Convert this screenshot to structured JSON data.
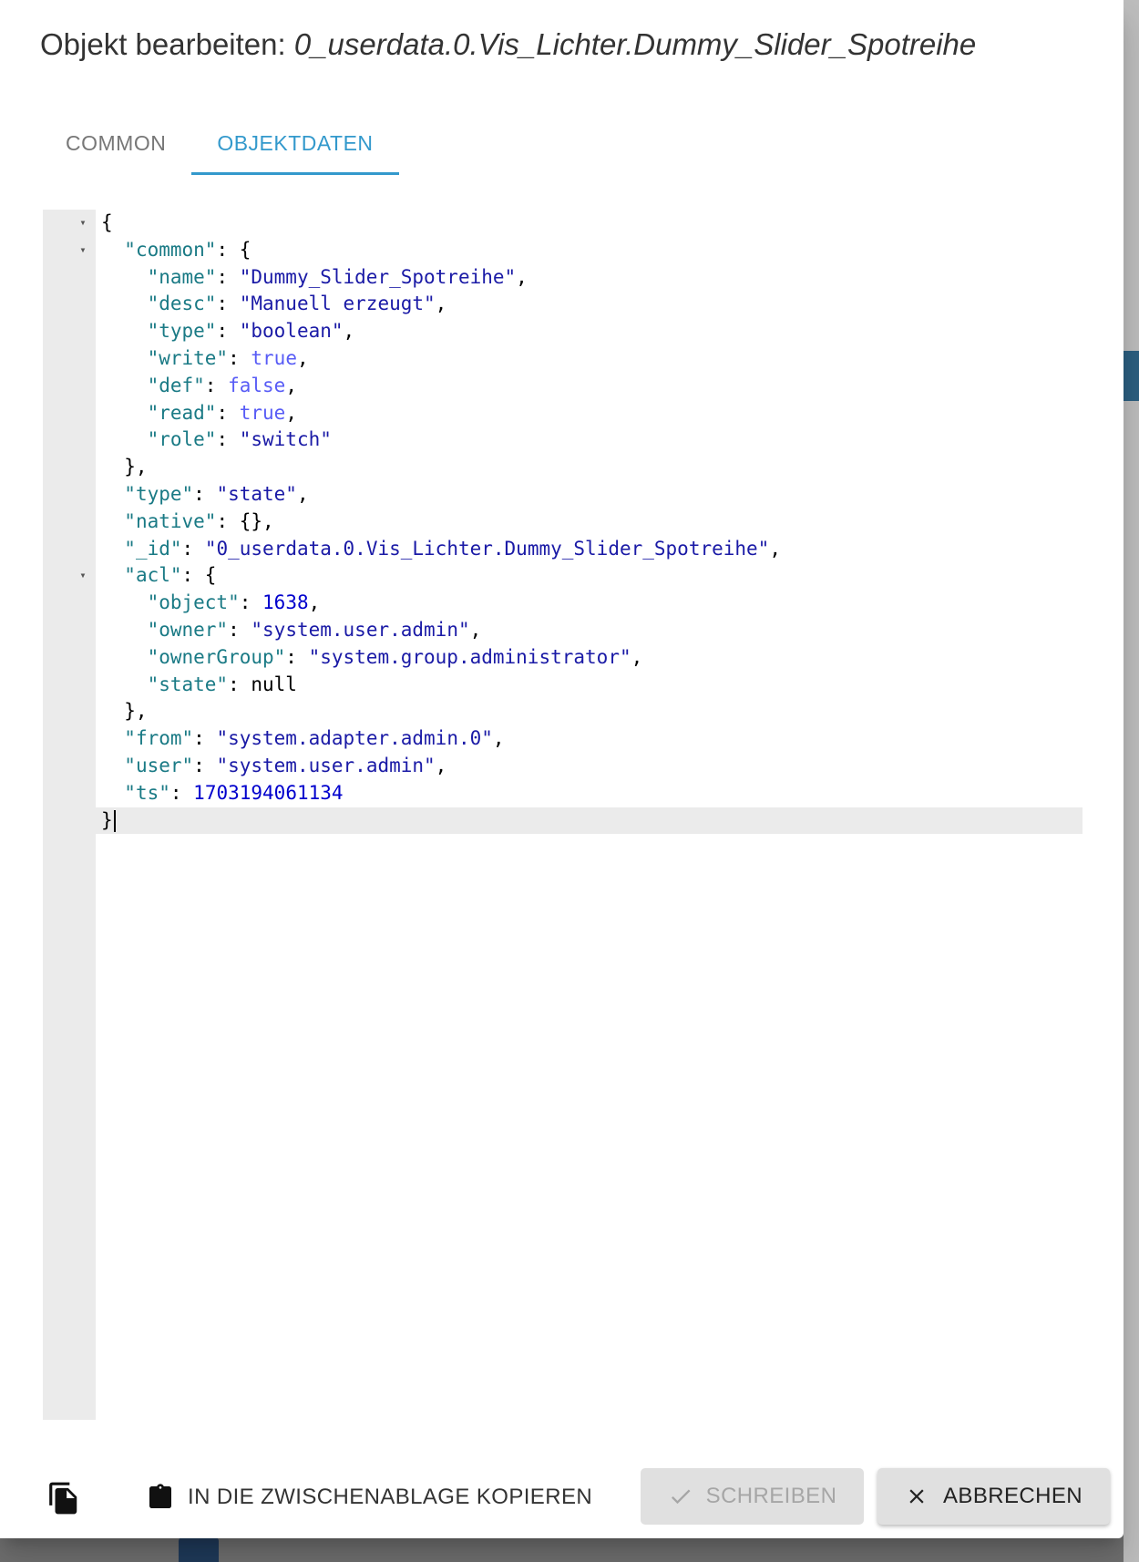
{
  "dialog": {
    "title_prefix": "Objekt bearbeiten: ",
    "title_object_id": "0_userdata.0.Vis_Lichter.Dummy_Slider_Spotreihe"
  },
  "tabs": [
    {
      "label": "COMMON",
      "active": false
    },
    {
      "label": "OBJEKTDATEN",
      "active": true
    }
  ],
  "editor": {
    "lines": [
      {
        "fold": true,
        "tokens": [
          [
            "p",
            "{"
          ]
        ]
      },
      {
        "fold": true,
        "tokens": [
          [
            "p",
            "  "
          ],
          [
            "k",
            "\"common\""
          ],
          [
            "p",
            ": {"
          ]
        ]
      },
      {
        "fold": false,
        "tokens": [
          [
            "p",
            "    "
          ],
          [
            "k",
            "\"name\""
          ],
          [
            "p",
            ": "
          ],
          [
            "s",
            "\"Dummy_Slider_Spotreihe\""
          ],
          [
            "p",
            ","
          ]
        ]
      },
      {
        "fold": false,
        "tokens": [
          [
            "p",
            "    "
          ],
          [
            "k",
            "\"desc\""
          ],
          [
            "p",
            ": "
          ],
          [
            "s",
            "\"Manuell erzeugt\""
          ],
          [
            "p",
            ","
          ]
        ]
      },
      {
        "fold": false,
        "tokens": [
          [
            "p",
            "    "
          ],
          [
            "k",
            "\"type\""
          ],
          [
            "p",
            ": "
          ],
          [
            "s",
            "\"boolean\""
          ],
          [
            "p",
            ","
          ]
        ]
      },
      {
        "fold": false,
        "tokens": [
          [
            "p",
            "    "
          ],
          [
            "k",
            "\"write\""
          ],
          [
            "p",
            ": "
          ],
          [
            "b",
            "true"
          ],
          [
            "p",
            ","
          ]
        ]
      },
      {
        "fold": false,
        "tokens": [
          [
            "p",
            "    "
          ],
          [
            "k",
            "\"def\""
          ],
          [
            "p",
            ": "
          ],
          [
            "b",
            "false"
          ],
          [
            "p",
            ","
          ]
        ]
      },
      {
        "fold": false,
        "tokens": [
          [
            "p",
            "    "
          ],
          [
            "k",
            "\"read\""
          ],
          [
            "p",
            ": "
          ],
          [
            "b",
            "true"
          ],
          [
            "p",
            ","
          ]
        ]
      },
      {
        "fold": false,
        "tokens": [
          [
            "p",
            "    "
          ],
          [
            "k",
            "\"role\""
          ],
          [
            "p",
            ": "
          ],
          [
            "s",
            "\"switch\""
          ]
        ]
      },
      {
        "fold": false,
        "tokens": [
          [
            "p",
            "  },"
          ]
        ]
      },
      {
        "fold": false,
        "tokens": [
          [
            "p",
            "  "
          ],
          [
            "k",
            "\"type\""
          ],
          [
            "p",
            ": "
          ],
          [
            "s",
            "\"state\""
          ],
          [
            "p",
            ","
          ]
        ]
      },
      {
        "fold": false,
        "tokens": [
          [
            "p",
            "  "
          ],
          [
            "k",
            "\"native\""
          ],
          [
            "p",
            ": {},"
          ]
        ]
      },
      {
        "fold": false,
        "tokens": [
          [
            "p",
            "  "
          ],
          [
            "k",
            "\"_id\""
          ],
          [
            "p",
            ": "
          ],
          [
            "s",
            "\"0_userdata.0.Vis_Lichter.Dummy_Slider_Spotreihe\""
          ],
          [
            "p",
            ","
          ]
        ]
      },
      {
        "fold": true,
        "tokens": [
          [
            "p",
            "  "
          ],
          [
            "k",
            "\"acl\""
          ],
          [
            "p",
            ": {"
          ]
        ]
      },
      {
        "fold": false,
        "tokens": [
          [
            "p",
            "    "
          ],
          [
            "k",
            "\"object\""
          ],
          [
            "p",
            ": "
          ],
          [
            "n",
            "1638"
          ],
          [
            "p",
            ","
          ]
        ]
      },
      {
        "fold": false,
        "tokens": [
          [
            "p",
            "    "
          ],
          [
            "k",
            "\"owner\""
          ],
          [
            "p",
            ": "
          ],
          [
            "s",
            "\"system.user.admin\""
          ],
          [
            "p",
            ","
          ]
        ]
      },
      {
        "fold": false,
        "tokens": [
          [
            "p",
            "    "
          ],
          [
            "k",
            "\"ownerGroup\""
          ],
          [
            "p",
            ": "
          ],
          [
            "s",
            "\"system.group.administrator\""
          ],
          [
            "p",
            ","
          ]
        ]
      },
      {
        "fold": false,
        "tokens": [
          [
            "p",
            "    "
          ],
          [
            "k",
            "\"state\""
          ],
          [
            "p",
            ": null"
          ]
        ]
      },
      {
        "fold": false,
        "tokens": [
          [
            "p",
            "  },"
          ]
        ]
      },
      {
        "fold": false,
        "tokens": [
          [
            "p",
            "  "
          ],
          [
            "k",
            "\"from\""
          ],
          [
            "p",
            ": "
          ],
          [
            "s",
            "\"system.adapter.admin.0\""
          ],
          [
            "p",
            ","
          ]
        ]
      },
      {
        "fold": false,
        "tokens": [
          [
            "p",
            "  "
          ],
          [
            "k",
            "\"user\""
          ],
          [
            "p",
            ": "
          ],
          [
            "s",
            "\"system.user.admin\""
          ],
          [
            "p",
            ","
          ]
        ]
      },
      {
        "fold": false,
        "tokens": [
          [
            "p",
            "  "
          ],
          [
            "k",
            "\"ts\""
          ],
          [
            "p",
            ": "
          ],
          [
            "n",
            "1703194061134"
          ]
        ]
      },
      {
        "fold": false,
        "active": true,
        "cursor": true,
        "tokens": [
          [
            "p",
            "}"
          ]
        ]
      }
    ]
  },
  "actions": {
    "copy_clipboard_label": "IN DIE ZWISCHENABLAGE KOPIEREN",
    "write_label": "SCHREIBEN",
    "write_disabled": true,
    "cancel_label": "ABBRECHEN"
  },
  "icons": {
    "copy": "file-copy-icon",
    "clipboard": "clipboard-icon",
    "check": "check-icon",
    "close": "close-icon",
    "fold": "fold-arrow-icon"
  },
  "colors": {
    "accent": "#3399cc",
    "json_key": "#1a7a85",
    "json_string": "#1a1aa6",
    "json_number": "#0000cd",
    "json_boolean": "#585cf6",
    "gutter": "#ebebeb"
  }
}
